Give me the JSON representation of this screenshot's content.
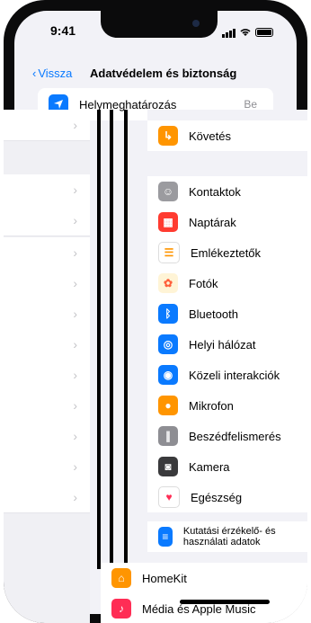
{
  "status": {
    "time": "9:41"
  },
  "nav": {
    "back_label": "Vissza",
    "title": "Adatvédelem és biztonság"
  },
  "top_row": {
    "label": "Helymeghatározás",
    "value": "Be"
  },
  "items": [
    {
      "label": "Követés",
      "icon": "follow-icon",
      "color": "#ff9500"
    },
    {
      "label": "Kontaktok",
      "icon": "contacts-icon",
      "color": "#9b9b9f"
    },
    {
      "label": "Naptárak",
      "icon": "calendar-icon",
      "color": "#ff3b30"
    },
    {
      "label": "Emlékeztetők",
      "icon": "reminders-icon",
      "color": "#ffffff"
    },
    {
      "label": "Fotók",
      "icon": "photos-icon",
      "color": "#ffcc00"
    },
    {
      "label": "Bluetooth",
      "icon": "bluetooth-icon",
      "color": "#0a7aff"
    },
    {
      "label": "Helyi hálózat",
      "icon": "globe-icon",
      "color": "#0a7aff"
    },
    {
      "label": "Közeli interakciók",
      "icon": "nearby-icon",
      "color": "#0a7aff"
    },
    {
      "label": "Mikrofon",
      "icon": "microphone-icon",
      "color": "#ff9500"
    },
    {
      "label": "Beszédfelismerés",
      "icon": "speech-icon",
      "color": "#8e8e93"
    },
    {
      "label": "Kamera",
      "icon": "camera-icon",
      "color": "#3a3a3c"
    },
    {
      "label": "Egészség",
      "icon": "health-icon",
      "color": "#ffffff"
    },
    {
      "label": "Kutatási érzékelő- és használati adatok",
      "icon": "research-icon",
      "color": "#0a7aff"
    },
    {
      "label": "HomeKit",
      "icon": "homekit-icon",
      "color": "#ff9500"
    },
    {
      "label": "Média és Apple Music",
      "icon": "music-icon",
      "color": "#ff2d55"
    }
  ]
}
